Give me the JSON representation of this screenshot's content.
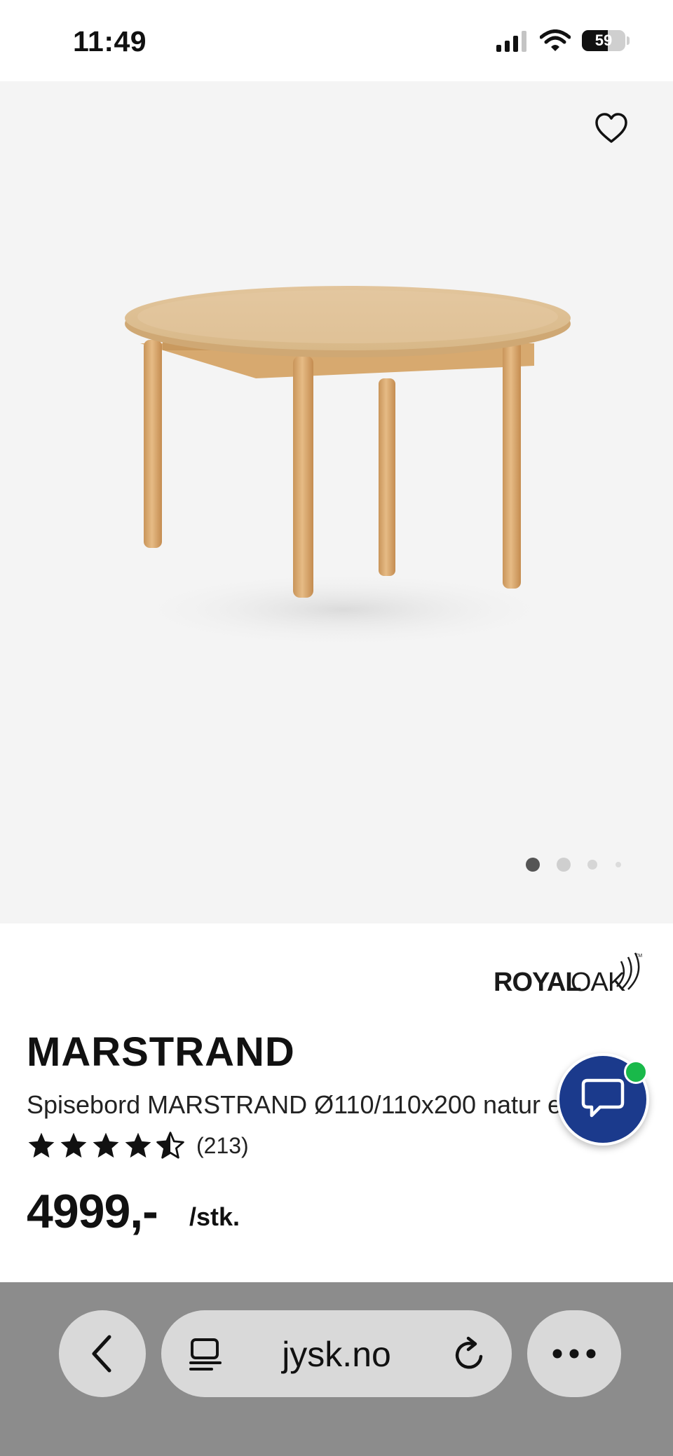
{
  "status_bar": {
    "time": "11:49",
    "battery_level": "59",
    "battery_percent": 59
  },
  "hero": {
    "favorite_icon": "heart-outline-icon",
    "image_count": 4,
    "active_image_index": 0
  },
  "brand": {
    "name": "ROYALOAK",
    "name_part1": "ROYAL",
    "name_part2": "OAK",
    "trademark": "TM"
  },
  "product": {
    "name": "MARSTRAND",
    "description": "Spisebord MARSTRAND Ø110/110x200 natur eik",
    "rating": 4.5,
    "rating_max": 5,
    "review_count": "(213)",
    "price": "4999,-",
    "unit": "/stk."
  },
  "chat": {
    "icon": "chat-bubble-icon",
    "online": true
  },
  "browser": {
    "url": "jysk.no",
    "back_icon": "chevron-left-icon",
    "reader_icon": "reader-mode-icon",
    "reload_icon": "reload-icon",
    "more_icon": "more-horizontal-icon"
  },
  "colors": {
    "chat_button": "#1b3a8c",
    "online_indicator": "#19b94a",
    "hero_background": "#f4f4f4",
    "browser_bar": "#8c8c8c"
  }
}
